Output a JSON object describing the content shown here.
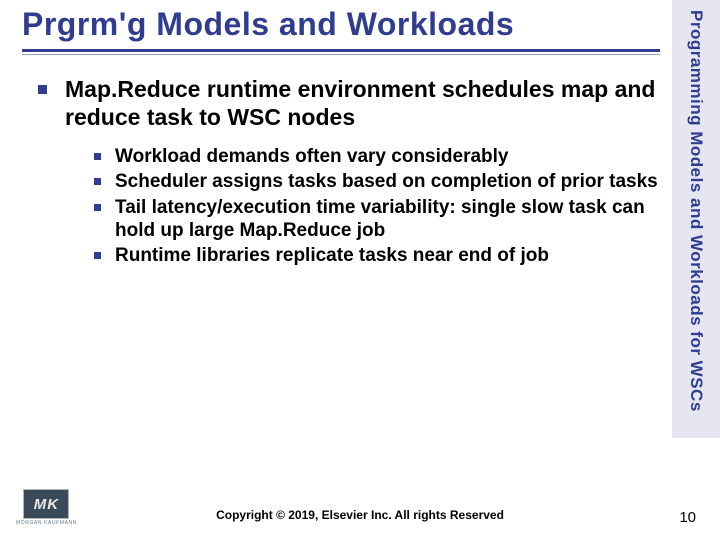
{
  "title": "Prgrm'g Models and Workloads",
  "side_label": "Programming Models and Workloads for WSCs",
  "main_bullet": "Map.Reduce runtime environment schedules map and reduce task to WSC nodes",
  "sub_bullets": [
    "Workload demands often vary considerably",
    "Scheduler assigns tasks based on completion of prior tasks",
    "Tail latency/execution time variability:  single slow task can hold up large Map.Reduce job",
    "Runtime libraries replicate tasks near end of job"
  ],
  "logo_text": "MK",
  "logo_sub": "MORGAN KAUFMANN",
  "copyright": "Copyright © 2019, Elsevier Inc. All rights Reserved",
  "page_number": "10"
}
